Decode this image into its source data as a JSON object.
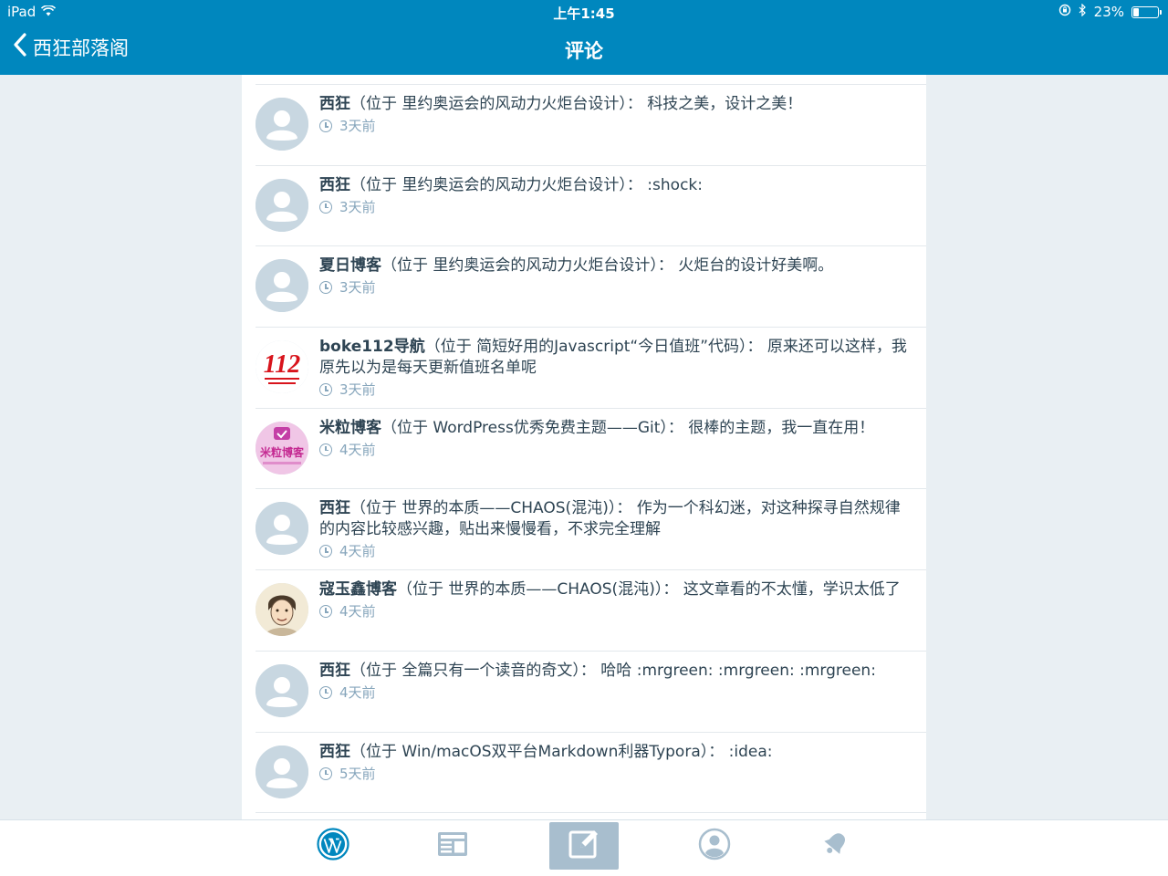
{
  "status": {
    "device": "iPad",
    "time": "上午1:45",
    "battery": "23%",
    "battery_level": 0.23
  },
  "nav": {
    "back_label": "西狂部落阁",
    "title": "评论"
  },
  "comments": [
    {
      "author": "西狂",
      "post": "（位于 里约奥运会的风动力火炬台设计）：",
      "text": " 科技之美，设计之美！",
      "time": "3天前",
      "avatar": "default-avatar"
    },
    {
      "author": "西狂",
      "post": "（位于 里约奥运会的风动力火炬台设计）：",
      "text": " :shock:",
      "time": "3天前",
      "avatar": "default-avatar"
    },
    {
      "author": "夏日博客",
      "post": "（位于 里约奥运会的风动力火炬台设计）：",
      "text": " 火炬台的设计好美啊。",
      "time": "3天前",
      "avatar": "default-avatar"
    },
    {
      "author": "boke112导航",
      "post": "（位于 简短好用的Javascript“今日值班”代码）：",
      "text": " 原来还可以这样，我原先以为是每天更新值班名单呢",
      "time": "3天前",
      "avatar": "boke112-logo"
    },
    {
      "author": "米粒博客",
      "post": "（位于 WordPress优秀免费主题——Git）：",
      "text": " 很棒的主题，我一直在用！",
      "time": "4天前",
      "avatar": "mili-logo"
    },
    {
      "author": "西狂",
      "post": "（位于 世界的本质——CHAOS(混沌)）：",
      "text": " 作为一个科幻迷，对这种探寻自然规律的内容比较感兴趣，贴出来慢慢看，不求完全理解",
      "time": "4天前",
      "avatar": "default-avatar"
    },
    {
      "author": "寇玉鑫博客",
      "post": "（位于 世界的本质——CHAOS(混沌)）：",
      "text": " 这文章看的不太懂，学识太低了",
      "time": "4天前",
      "avatar": "portrait-avatar"
    },
    {
      "author": "西狂",
      "post": "（位于 全篇只有一个读音的奇文）：",
      "text": " 哈哈 :mrgreen: :mrgreen: :mrgreen:",
      "time": "4天前",
      "avatar": "default-avatar"
    },
    {
      "author": "西狂",
      "post": "（位于 Win/macOS双平台Markdown利器Typora）：",
      "text": " :idea:",
      "time": "5天前",
      "avatar": "default-avatar"
    }
  ],
  "avatar_texts": {
    "boke112": "112",
    "mili": "米粒博客"
  },
  "tabs": [
    {
      "name": "wordpress-icon",
      "active": false
    },
    {
      "name": "reader-icon",
      "active": false
    },
    {
      "name": "write-post-icon",
      "active": true
    },
    {
      "name": "me-icon",
      "active": false
    },
    {
      "name": "notifications-icon",
      "active": false
    }
  ],
  "colors": {
    "header": "#0087be",
    "tab_active": "#a8bece",
    "meta": "#87a6bc"
  }
}
